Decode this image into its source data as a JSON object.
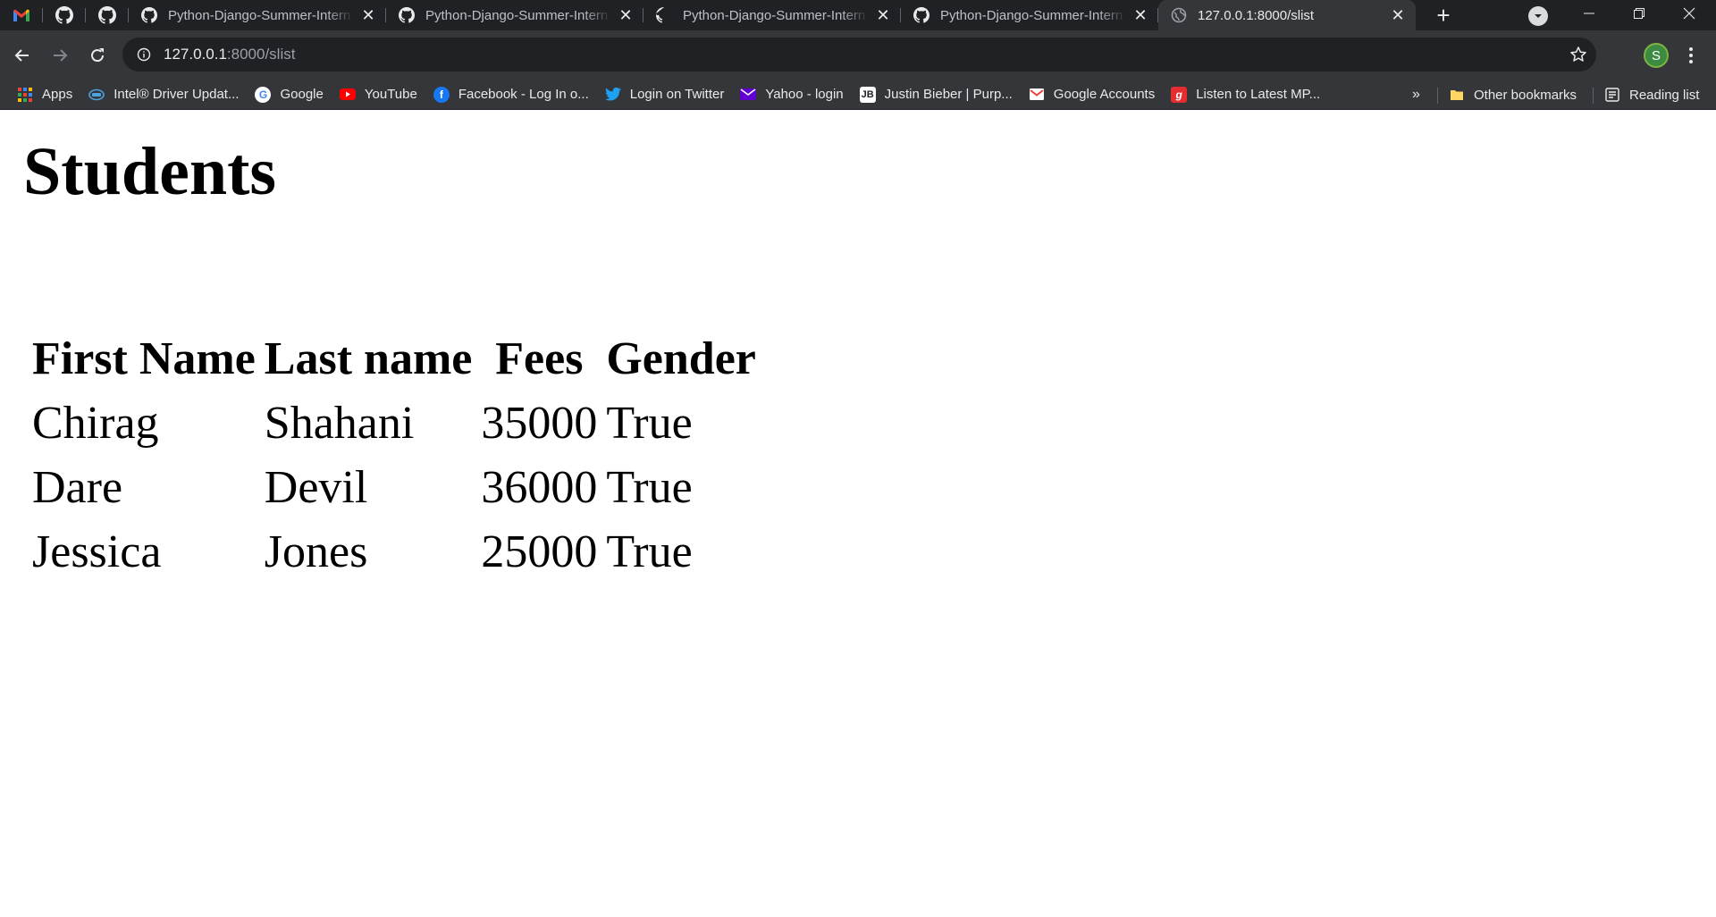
{
  "browser": {
    "pinned_tabs": [
      {
        "icon": "gmail-icon"
      },
      {
        "icon": "github-icon"
      },
      {
        "icon": "github-icon"
      }
    ],
    "tabs": [
      {
        "title": "Python-Django-Summer-Intern",
        "icon": "github-icon",
        "active": false
      },
      {
        "title": "Python-Django-Summer-Intern",
        "icon": "github-icon",
        "active": false
      },
      {
        "title": "Python-Django-Summer-Intern",
        "icon": "github-icon",
        "active": false
      },
      {
        "title": "Python-Django-Summer-Intern",
        "icon": "github-icon",
        "active": false
      },
      {
        "title": "127.0.0.1:8000/slist",
        "icon": "globe-icon",
        "active": true
      }
    ],
    "address": {
      "host": "127.0.0.1",
      "path": ":8000/slist"
    },
    "profile_initial": "S",
    "bookmarks": [
      {
        "label": "Apps",
        "icon": "apps-grid-icon"
      },
      {
        "label": "Intel® Driver Updat...",
        "icon": "intel-icon"
      },
      {
        "label": "Google",
        "icon": "google-icon"
      },
      {
        "label": "YouTube",
        "icon": "youtube-icon"
      },
      {
        "label": "Facebook - Log In o...",
        "icon": "facebook-icon"
      },
      {
        "label": "Login on Twitter",
        "icon": "twitter-icon"
      },
      {
        "label": "Yahoo - login",
        "icon": "yahoo-mail-icon"
      },
      {
        "label": "Justin Bieber | Purp...",
        "icon": "jb-icon"
      },
      {
        "label": "Google Accounts",
        "icon": "gmail-icon"
      },
      {
        "label": "Listen to Latest MP...",
        "icon": "gaana-icon"
      }
    ],
    "bookmarks_more": "»",
    "other_bookmarks": "Other bookmarks",
    "reading_list": "Reading list"
  },
  "page": {
    "title": "Students",
    "table": {
      "headers": [
        "First Name",
        "Last name",
        "Fees",
        "Gender"
      ],
      "rows": [
        [
          "Chirag",
          "Shahani",
          "35000",
          "True"
        ],
        [
          "Dare",
          "Devil",
          "36000",
          "True"
        ],
        [
          "Jessica",
          "Jones",
          "25000",
          "True"
        ]
      ]
    }
  },
  "colors": {
    "tab_strip": "#202124",
    "toolbar": "#35363a",
    "omnibox": "#202124",
    "avatar": "#3d8b40"
  }
}
